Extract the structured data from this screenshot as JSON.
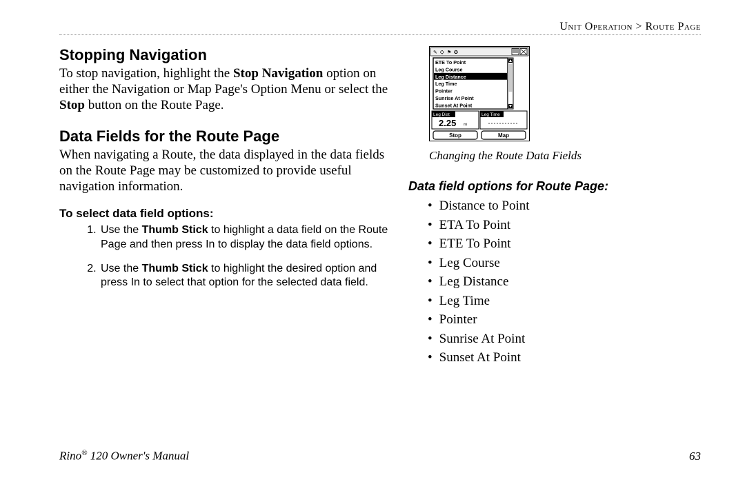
{
  "breadcrumb": {
    "section": "Unit Operation",
    "sep": ">",
    "page": "Route Page"
  },
  "left": {
    "stopNav": {
      "heading": "Stopping Navigation",
      "pre": "To stop navigation, highlight the ",
      "bold1": "Stop Navigation",
      "mid": " option on either the Navigation or Map Page's Option Menu or select the ",
      "bold2": "Stop",
      "post": " button on the Route Page."
    },
    "dataFields": {
      "heading": "Data Fields for the Route Page",
      "body": "When navigating a Route, the data displayed in the data fields on the Route Page may be customized to provide useful navigation information."
    },
    "select": {
      "heading": "To select data field options:",
      "steps": [
        {
          "pre": "Use the ",
          "bold": "Thumb Stick",
          "post": " to highlight a data field on the Route Page and then press In to display the data field options."
        },
        {
          "pre": "Use the ",
          "bold": "Thumb Stick",
          "post": " to highlight the desired option and press In to select that option for the selected data field."
        }
      ]
    }
  },
  "right": {
    "device": {
      "menuItems": [
        "ETE To Point",
        "Leg Course",
        "Leg Distance",
        "Leg Time",
        "Pointer",
        "Sunrise At Point",
        "Sunset At Point"
      ],
      "highlightedIndex": 2,
      "bottomFields": {
        "leftLabel": "Leg Dist",
        "rightLabel": "Leg Time",
        "leftValue": "2.25",
        "leftUnit": "mi"
      },
      "buttons": {
        "left": "Stop",
        "right": "Map"
      }
    },
    "caption": "Changing the Route Data Fields",
    "optsHeading": "Data field options for Route Page:",
    "opts": [
      "Distance to Point",
      "ETA To Point",
      "ETE To Point",
      "Leg Course",
      "Leg Distance",
      "Leg Time",
      "Pointer",
      "Sunrise At Point",
      "Sunset At Point"
    ]
  },
  "footer": {
    "product": "Rino",
    "model": " 120 Owner's Manual",
    "pageNum": "63"
  }
}
